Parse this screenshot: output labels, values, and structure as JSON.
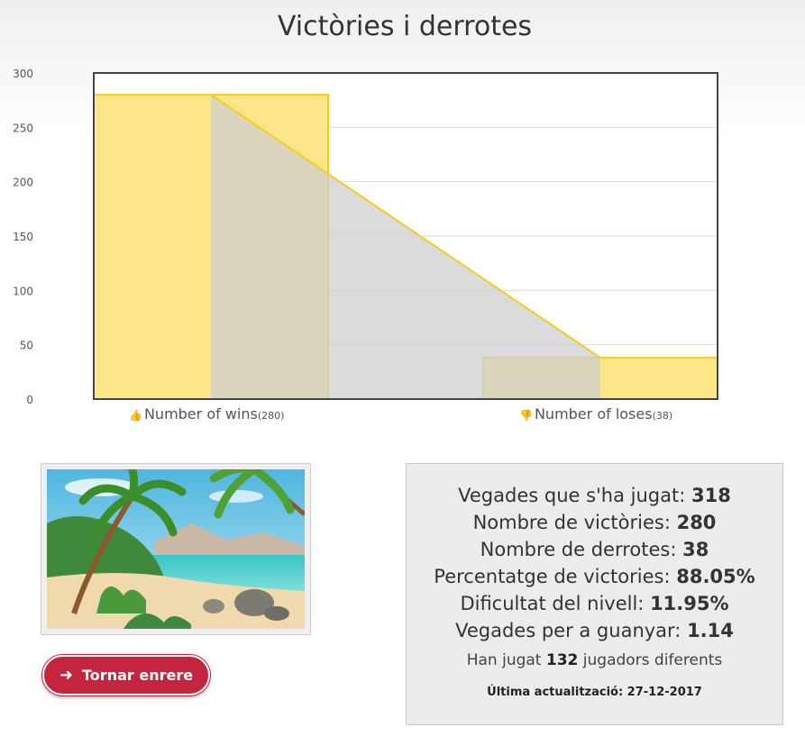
{
  "chart_data": {
    "type": "bar",
    "title": "Victòries i derrotes",
    "categories": [
      "Number of wins",
      "Number of loses"
    ],
    "category_counts": [
      "(280)",
      "(38)"
    ],
    "values": [
      280,
      38
    ],
    "ylim": [
      0,
      300
    ],
    "yticks": [
      0,
      50,
      100,
      150,
      200,
      250,
      300
    ],
    "grid": true,
    "overlay": "area connecting bar values",
    "colors": {
      "bar_fill": "#fde68a",
      "bar_stroke": "#f6cc1c",
      "area_fill": "#cfcfcf",
      "axis": "#444444"
    }
  },
  "back_button": {
    "label": "Tornar enrere",
    "icon": "arrow-left-icon"
  },
  "stats": {
    "lines": [
      {
        "label": "Vegades que s'ha jugat: ",
        "value": "318"
      },
      {
        "label": "Nombre de victòries: ",
        "value": "280"
      },
      {
        "label": "Nombre de derrotes: ",
        "value": "38"
      },
      {
        "label": "Percentatge de victories: ",
        "value": "88.05%"
      },
      {
        "label": "Dificultat del nivell: ",
        "value": "11.95%"
      },
      {
        "label": "Vegades per a guanyar: ",
        "value": "1.14"
      }
    ],
    "players_prefix": "Han jugat ",
    "players_count": "132",
    "players_suffix": " jugadors diferents",
    "last_update": "Última actualització: 27-12-2017"
  }
}
